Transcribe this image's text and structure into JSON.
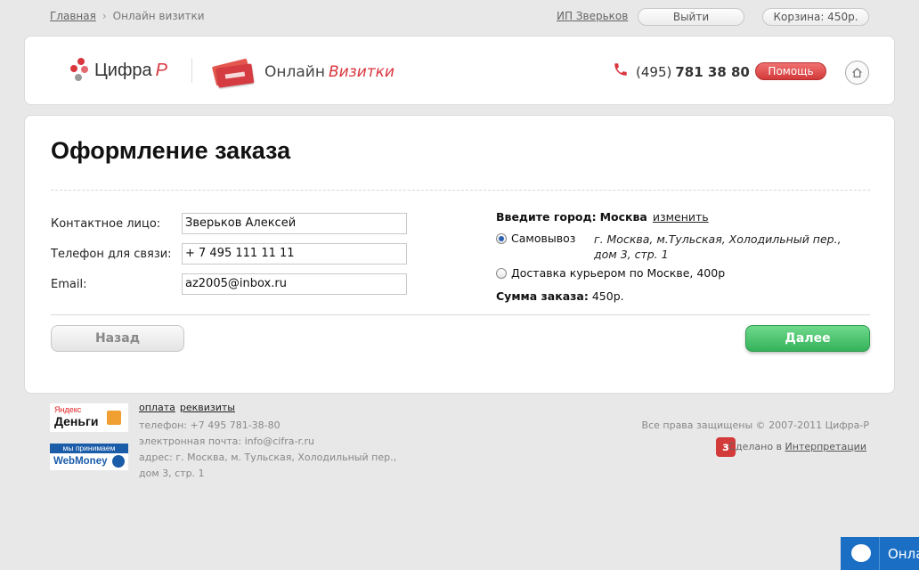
{
  "topbar": {
    "breadcrumb_home": "Главная",
    "breadcrumb_current": "Онлайн визитки",
    "user": "ИП Зверьков",
    "logout": "Выйти",
    "cart": "Корзина: 450р."
  },
  "header": {
    "logo_main": "Цифра",
    "logo_accent": "Р",
    "brand_main": "Онлайн",
    "brand_accent": "Визитки",
    "phone_code": "(495)",
    "phone_number": "781 38 80",
    "help": "Помощь",
    "icons": [
      "phone-icon",
      "home-icon"
    ],
    "accent_color": "#d9363e"
  },
  "form": {
    "title": "Оформление заказа",
    "contact_label": "Контактное лицо:",
    "contact_value": "Зверьков Алексей",
    "phone_label": "Телефон для связи:",
    "phone_value": "+ 7 495 111 11 11",
    "email_label": "Email:",
    "email_value": "az2005@inbox.ru",
    "city_prefix": "Введите город:",
    "city_value": "Москва",
    "city_change": "изменить",
    "pickup_label": "Самовывоз",
    "pickup_address": "г. Москва, м.Тульская, Холодильный пер., дом 3, стр. 1",
    "courier_label": "Доставка курьером по Москве, 400р",
    "total_label": "Сумма заказа:",
    "total_value": "450р.",
    "back": "Назад",
    "next": "Далее",
    "selected_delivery": "pickup",
    "next_color": "#35b35a"
  },
  "footer": {
    "yandex_top": "Яндекс",
    "yandex_main": "Деньги",
    "wm_top": "мы принимаем",
    "wm_main": "WebMoney",
    "link_payment": "оплата",
    "link_details": "реквизиты",
    "phone": "телефон: +7 495 781-38-80",
    "email": "электронная почта: info@cifra-r.ru",
    "address1": "адрес: г. Москва, м. Тульская, Холодильный пер.,",
    "address2": "дом 3, стр. 1",
    "copyright": "Все права защищены © 2007-2011 Цифра-Р",
    "made_prefix": "Сделано в",
    "made_link": "Интерпретации"
  },
  "chat": {
    "label": "Онла"
  }
}
